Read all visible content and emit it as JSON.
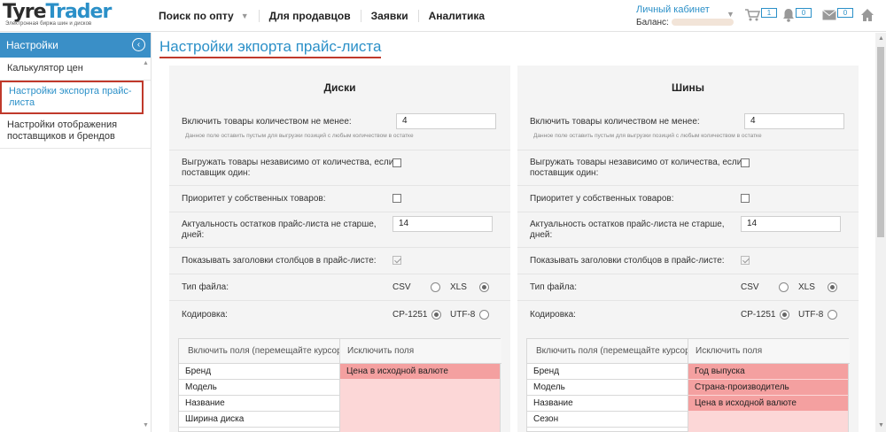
{
  "logo": {
    "part1": "Tyre",
    "part2": "Trader",
    "tagline": "Электронная биржа шин и дисков"
  },
  "nav": {
    "items": [
      {
        "label": "Поиск по опту"
      },
      {
        "label": "Для продавцов"
      },
      {
        "label": "Заявки"
      },
      {
        "label": "Аналитика"
      }
    ]
  },
  "account": {
    "link": "Личный кабинет",
    "balance_label": "Баланс:"
  },
  "badges": {
    "cart": "1",
    "notifications": "0",
    "messages": "0"
  },
  "sidebar": {
    "title": "Настройки",
    "items": [
      {
        "label": "Калькулятор цен"
      },
      {
        "label": "Настройки экспорта прайс-листа"
      },
      {
        "label": "Настройки отображения поставщиков и брендов"
      }
    ]
  },
  "page_title": "Настройки экпорта прайс-листа",
  "panels": [
    {
      "title": "Диски",
      "min_qty_label": "Включить товары количеством не менее:",
      "min_qty_value": "4",
      "min_qty_hint": "Данное поле оставить пустым для выгрузки позиций с любым количеством в остатке",
      "ignore_qty_label": "Выгружать товары независимо от количества, если поставщик один:",
      "priority_label": "Приоритет у собственных товаров:",
      "freshness_label": "Актуальность остатков прайс-листа не старше, дней:",
      "freshness_value": "14",
      "headers_label": "Показывать заголовки столбцов в прайс-листе:",
      "file_type_label": "Тип файла:",
      "file_csv": "CSV",
      "file_xls": "XLS",
      "encoding_label": "Кодировка:",
      "enc_cp": "CP-1251",
      "enc_utf": "UTF-8",
      "include_header": "Включить поля (перемещайте курсором)",
      "exclude_header": "Исключить поля",
      "include": [
        "Бренд",
        "Модель",
        "Название",
        "Ширина диска"
      ],
      "exclude": [
        "Цена в исходной валюте"
      ]
    },
    {
      "title": "Шины",
      "min_qty_label": "Включить товары количеством не менее:",
      "min_qty_value": "4",
      "min_qty_hint": "Данное поле оставить пустым для выгрузки позиций с любым количеством в остатке",
      "ignore_qty_label": "Выгружать товары независимо от количества, если поставщик один:",
      "priority_label": "Приоритет у собственных товаров:",
      "freshness_label": "Актуальность остатков прайс-листа не старше, дней:",
      "freshness_value": "14",
      "headers_label": "Показывать заголовки столбцов в прайс-листе:",
      "file_type_label": "Тип файла:",
      "file_csv": "CSV",
      "file_xls": "XLS",
      "encoding_label": "Кодировка:",
      "enc_cp": "CP-1251",
      "enc_utf": "UTF-8",
      "include_header": "Включить поля (перемещайте курсором)",
      "exclude_header": "Исключить поля",
      "include": [
        "Бренд",
        "Модель",
        "Название",
        "Сезон"
      ],
      "exclude": [
        "Год выпуска",
        "Страна-производитель",
        "Цена в исходной валюте"
      ]
    }
  ],
  "icons": {
    "cart": "cart-icon",
    "bell": "bell-icon",
    "mail": "mail-icon",
    "home": "home-icon",
    "collapse": "chevron-left-icon"
  },
  "colors": {
    "accent": "#2b90c8",
    "sidebar_head": "#3a8fc7",
    "highlight_border": "#c0392b",
    "excluded_item": "#f4a0a0",
    "excluded_area": "#fcd7d7"
  }
}
